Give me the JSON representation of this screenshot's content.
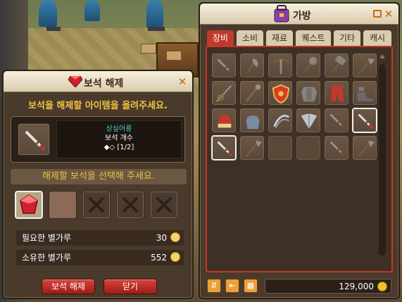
{
  "gem_window": {
    "title": "보석 해제",
    "instruction": "보석을 해제할 아이템을 올려주세요.",
    "item": {
      "name": "상실어룡",
      "gem_count_label": "보석 개수",
      "gem_count_value": "◆◇ [1/2]"
    },
    "select_prompt": "해제할 보석을 선택해 주세요.",
    "required_label": "필요한 별가루",
    "required_value": "30",
    "owned_label": "소유한 별가루",
    "owned_value": "552",
    "buttons": {
      "unsocket": "보석 해제",
      "close": "닫기"
    },
    "gem_slots": [
      {
        "state": "gem",
        "icon": "red-gem-icon"
      },
      {
        "state": "empty"
      },
      {
        "state": "locked",
        "icon": "x-mark-icon"
      },
      {
        "state": "locked",
        "icon": "x-mark-icon"
      },
      {
        "state": "locked",
        "icon": "x-mark-icon"
      }
    ]
  },
  "inventory": {
    "title": "가방",
    "tabs": [
      "장비",
      "소비",
      "재료",
      "퀘스트",
      "기타",
      "캐시"
    ],
    "active_tab": "장비",
    "meso": "129,000",
    "items": [
      {
        "icon": "sword-icon",
        "dim": true
      },
      {
        "icon": "axe-icon",
        "dim": true
      },
      {
        "icon": "crossbow-icon",
        "dim": true
      },
      {
        "icon": "mace-icon",
        "dim": true
      },
      {
        "icon": "hammer-icon",
        "dim": true
      },
      {
        "icon": "polearm-icon",
        "dim": true
      },
      {
        "icon": "rapier-icon",
        "dim": true
      },
      {
        "icon": "staff-icon",
        "dim": true
      },
      {
        "icon": "shield-icon",
        "dim": false
      },
      {
        "icon": "armor-icon",
        "dim": true
      },
      {
        "icon": "pants-icon",
        "dim": false
      },
      {
        "icon": "shoes-icon",
        "dim": true
      },
      {
        "icon": "helmet-icon",
        "dim": false
      },
      {
        "icon": "gloves-icon",
        "dim": false
      },
      {
        "icon": "claw-icon",
        "dim": false
      },
      {
        "icon": "fan-icon",
        "dim": false
      },
      {
        "icon": "sword-icon",
        "dim": true
      },
      {
        "icon": "sword-icon",
        "dim": false,
        "selected": true
      },
      {
        "icon": "sword-icon",
        "dim": false,
        "selected": true
      },
      {
        "icon": "polearm-icon",
        "dim": true
      },
      {
        "icon": "empty"
      },
      {
        "icon": "empty"
      },
      {
        "icon": "sword-icon",
        "dim": true
      },
      {
        "icon": "polearm-icon",
        "dim": true
      }
    ]
  },
  "colors": {
    "gold_text": "#f0c040",
    "cyan_text": "#3fd3d8",
    "tab_active": "#c0392b",
    "button_red": "#c0392b"
  }
}
